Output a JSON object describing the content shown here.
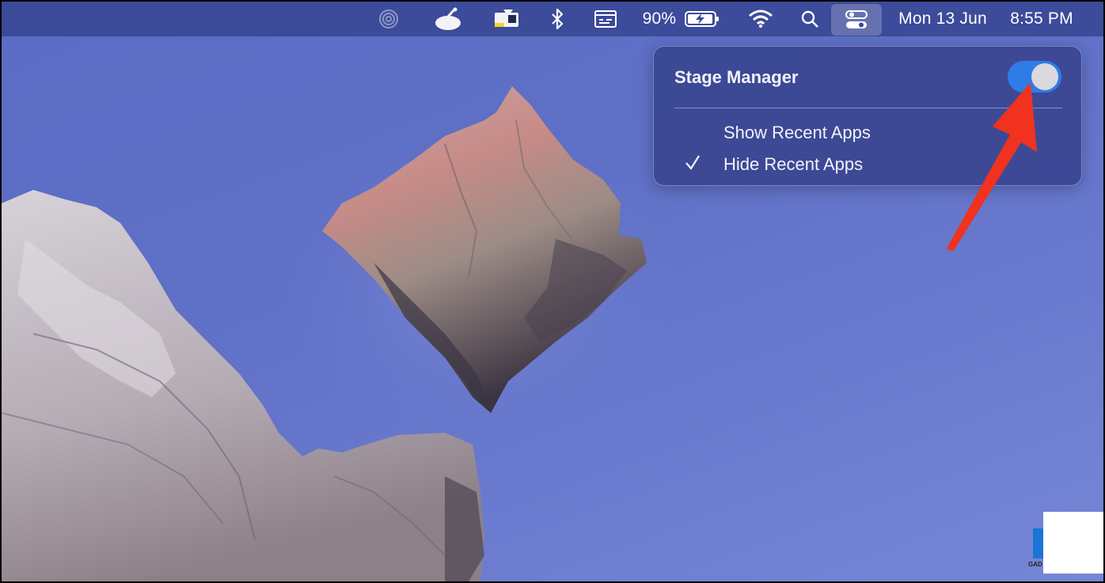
{
  "menubar": {
    "battery_percent": "90%",
    "date": "Mon 13 Jun",
    "time": "8:55 PM",
    "icons": [
      "airdrop-icon",
      "satellite-icon",
      "display-icon",
      "bluetooth-icon",
      "keyboard-icon",
      "battery-icon",
      "wifi-icon",
      "search-icon",
      "control-center-icon"
    ]
  },
  "popover": {
    "title": "Stage Manager",
    "toggle_state": "on",
    "options": [
      {
        "label": "Show Recent Apps",
        "checked": false
      },
      {
        "label": "Hide Recent Apps",
        "checked": true
      }
    ]
  },
  "colors": {
    "wallpaper": "#5f70c6",
    "menubar": "#3a4896",
    "toggle_on": "#2f7be8",
    "annotation_arrow": "#f0321e"
  },
  "watermark": {
    "text": "GAD"
  }
}
